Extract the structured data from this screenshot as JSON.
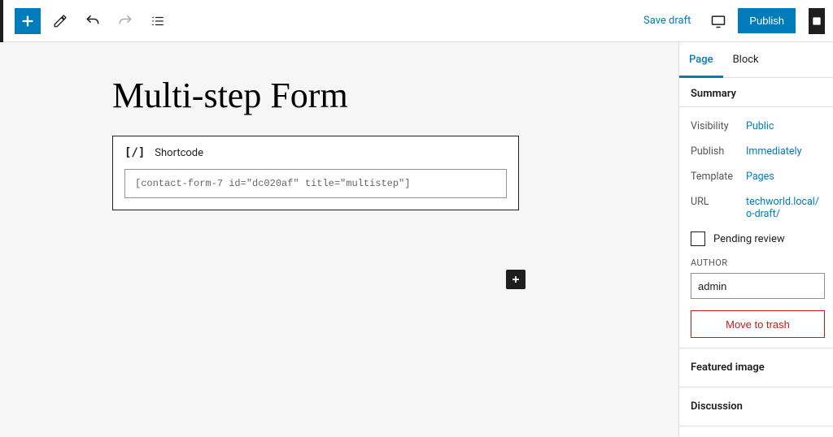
{
  "topbar": {
    "save_draft": "Save draft",
    "publish": "Publish"
  },
  "canvas": {
    "title": "Multi-step Form",
    "shortcode_block": {
      "label": "Shortcode",
      "value": "[contact-form-7 id=\"dc020af\" title=\"multistep\"]"
    }
  },
  "sidebar": {
    "tabs": {
      "page": "Page",
      "block": "Block"
    },
    "summary": {
      "heading": "Summary",
      "visibility_label": "Visibility",
      "visibility_value": "Public",
      "publish_label": "Publish",
      "publish_value": "Immediately",
      "template_label": "Template",
      "template_value": "Pages",
      "url_label": "URL",
      "url_value": "techworld.local/o-draft/",
      "pending_review": "Pending review",
      "author_label": "AUTHOR",
      "author_value": "admin",
      "move_to_trash": "Move to trash"
    },
    "panels": {
      "featured_image": "Featured image",
      "discussion": "Discussion"
    }
  }
}
